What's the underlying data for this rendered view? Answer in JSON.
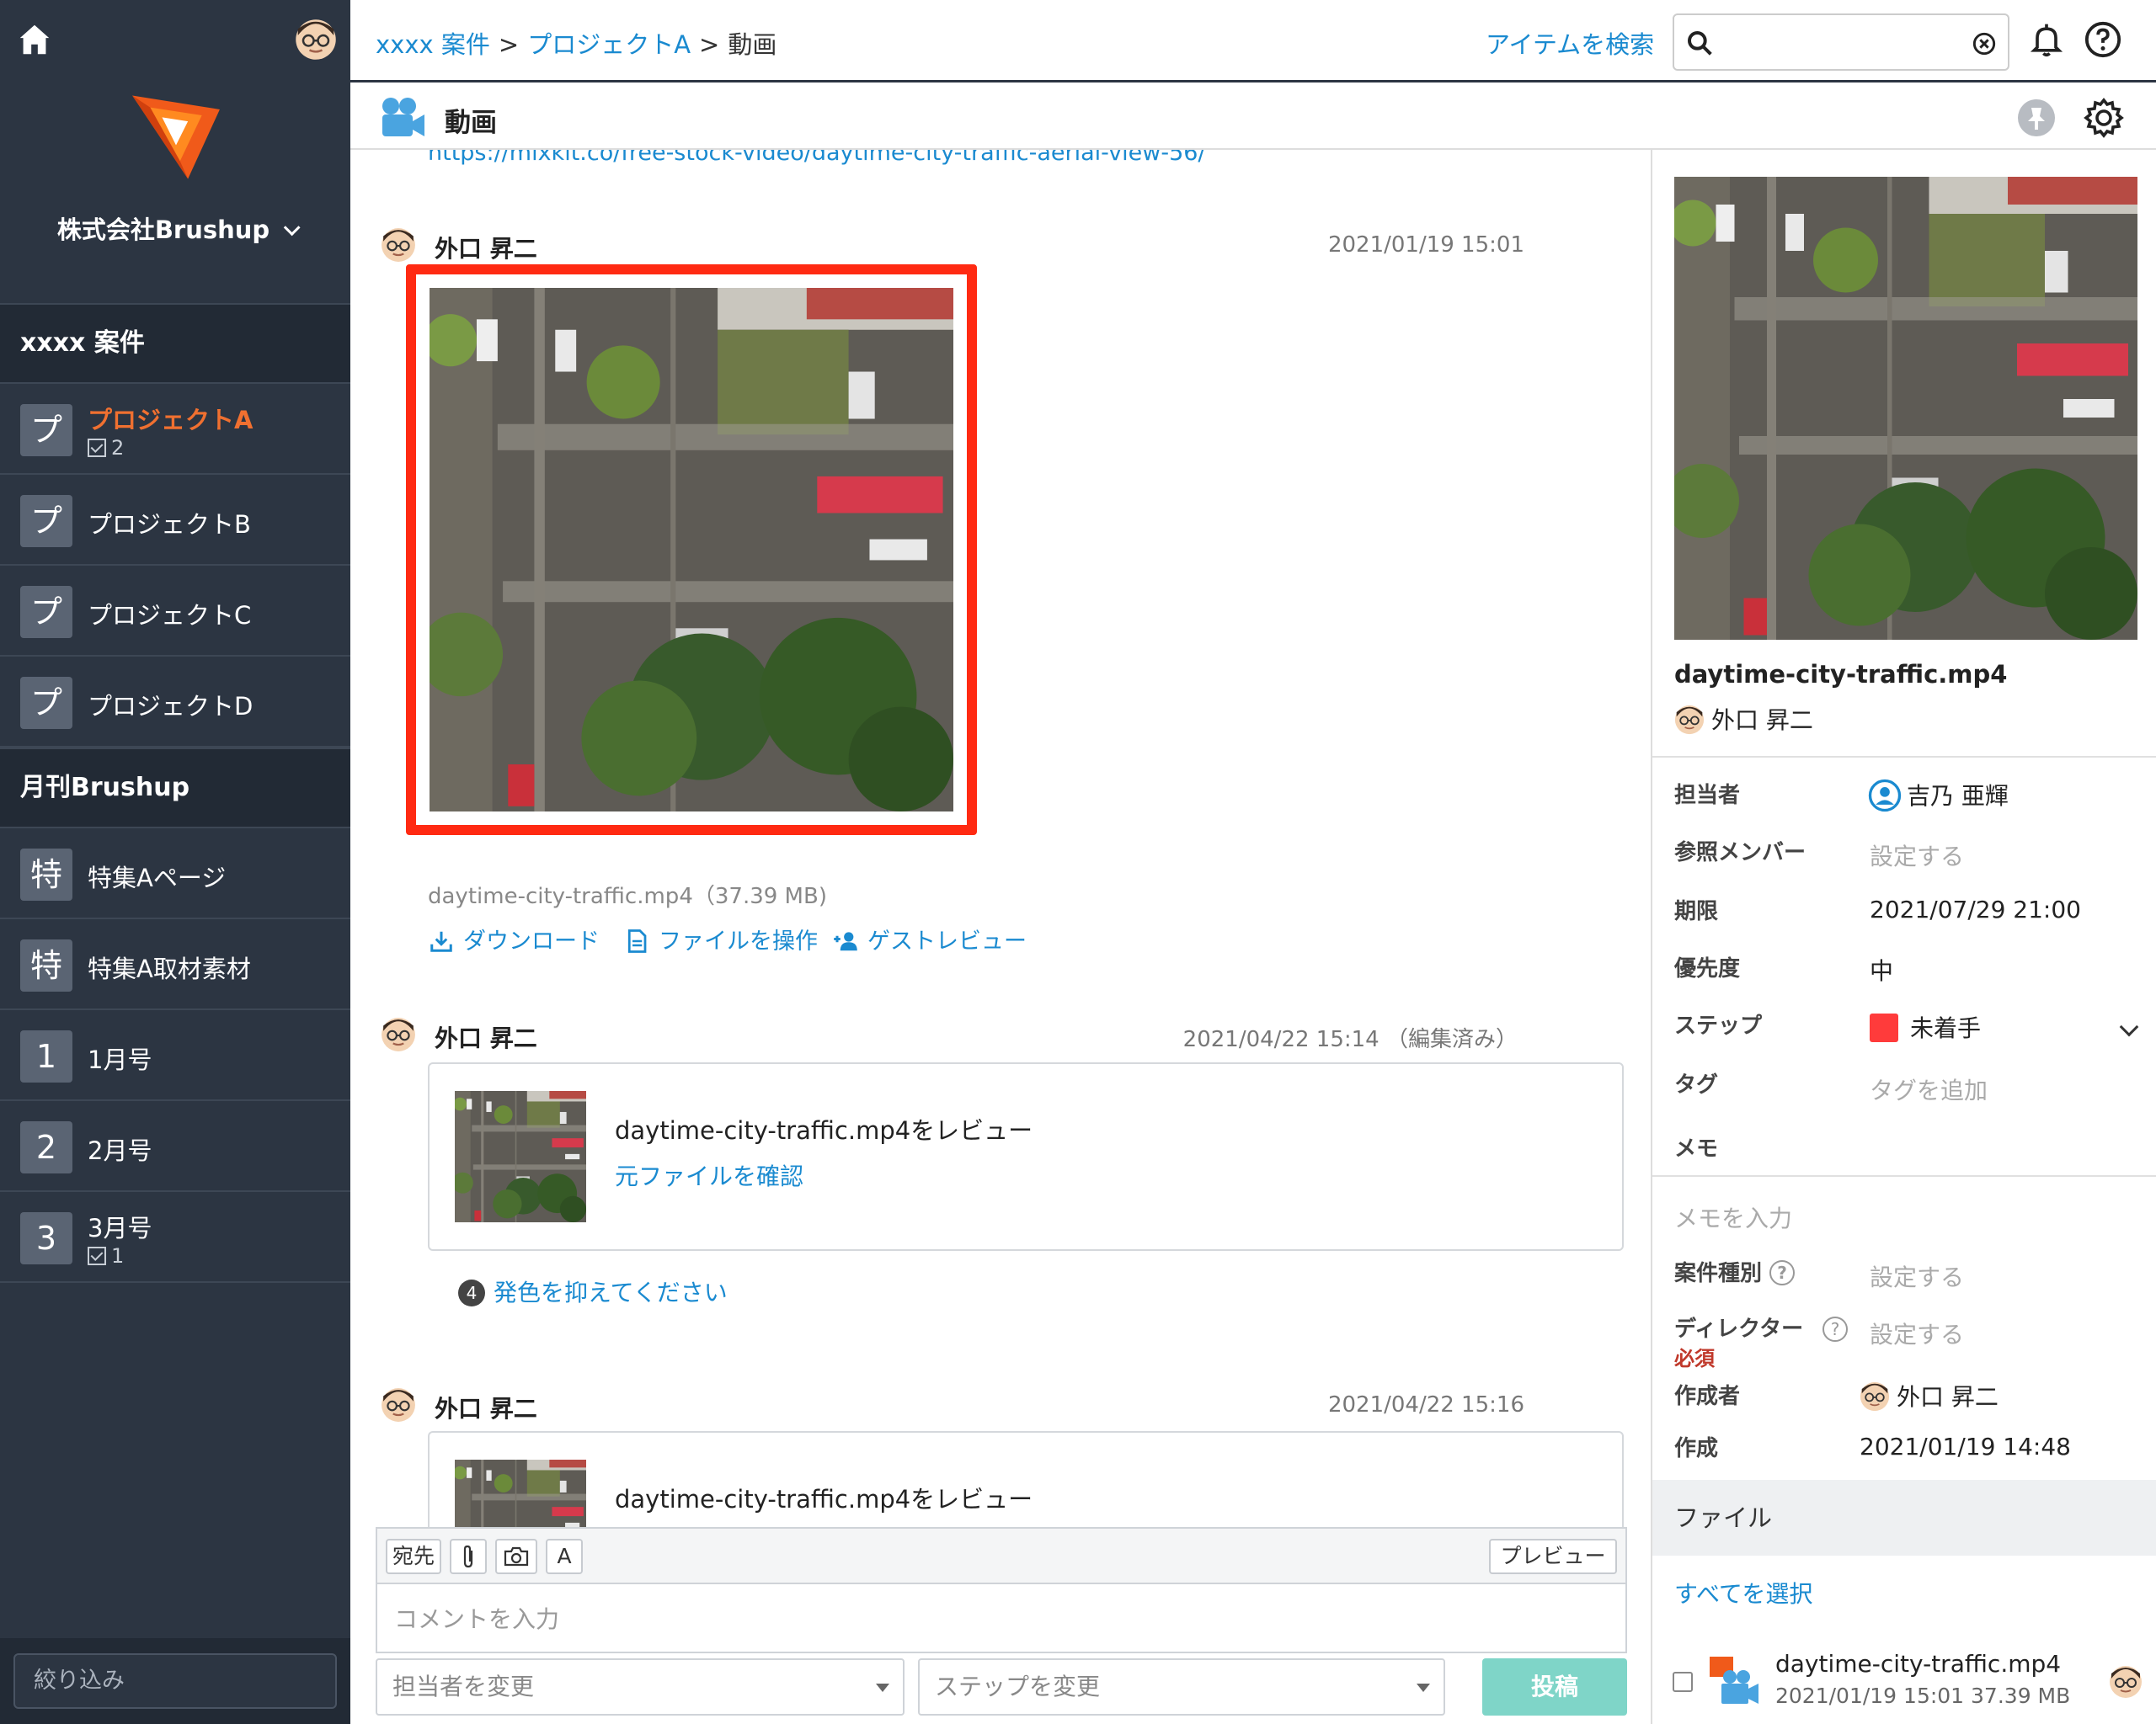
{
  "sidebar": {
    "company": "株式会社Brushup",
    "section1": "xxxx 案件",
    "projects": [
      {
        "tile": "プ",
        "label": "プロジェクトA",
        "count": "2"
      },
      {
        "tile": "プ",
        "label": "プロジェクトB"
      },
      {
        "tile": "プ",
        "label": "プロジェクトC"
      },
      {
        "tile": "プ",
        "label": "プロジェクトD"
      }
    ],
    "section2": "月刊Brushup",
    "items": [
      {
        "tile": "特",
        "label": "特集Aページ"
      },
      {
        "tile": "特",
        "label": "特集A取材素材"
      },
      {
        "tile": "1",
        "label": "1月号"
      },
      {
        "tile": "2",
        "label": "2月号"
      },
      {
        "tile": "3",
        "label": "3月号",
        "count": "1"
      }
    ],
    "filter_placeholder": "絞り込み"
  },
  "topbar": {
    "breadcrumb": [
      "xxxx 案件",
      "プロジェクトA",
      "動画"
    ],
    "separator": ">",
    "search_label": "アイテムを検索",
    "search_value": ""
  },
  "page": {
    "title": "動画"
  },
  "feed": {
    "top_link": "https://mixkit.co/free-stock-video/daytime-city-traffic-aerial-view-56/",
    "posts": [
      {
        "author": "外口 昇二",
        "timestamp": "2021/01/19 15:01",
        "file_caption": "daytime-city-traffic.mp4（37.39 MB)",
        "actions": [
          "ダウンロード",
          "ファイルを操作",
          "ゲストレビュー"
        ]
      },
      {
        "author": "外口 昇二",
        "timestamp": "2021/04/22 15:14 （編集済み）",
        "review_title": "daytime-city-traffic.mp4をレビュー",
        "review_link": "元ファイルを確認",
        "comment_number": "4",
        "comment_text": "発色を抑えてください"
      },
      {
        "author": "外口 昇二",
        "timestamp": "2021/04/22 15:16",
        "review_title": "daytime-city-traffic.mp4をレビュー"
      }
    ]
  },
  "composer": {
    "buttons": [
      "宛先",
      "A"
    ],
    "preview_label": "プレビュー",
    "placeholder": "コメントを入力",
    "assignee_select": "担当者を変更",
    "step_select": "ステップを変更",
    "post_label": "投稿"
  },
  "details": {
    "filename": "daytime-city-traffic.mp4",
    "author": "外口 昇二",
    "props": {
      "assignee_label": "担当者",
      "assignee_value": "吉乃 亜輝",
      "members_label": "参照メンバー",
      "members_value": "設定する",
      "due_label": "期限",
      "due_value": "2021/07/29 21:00",
      "priority_label": "優先度",
      "priority_value": "中",
      "step_label": "ステップ",
      "step_value": "未着手",
      "step_color": "#ff3b3b",
      "tag_label": "タグ",
      "tag_value": "タグを追加",
      "memo_label": "メモ",
      "memo_placeholder": "メモを入力",
      "type_label": "案件種別",
      "type_value": "設定する",
      "director_label": "ディレクター",
      "director_required": "必須",
      "director_value": "設定する",
      "creator_label": "作成者",
      "creator_value": "外口 昇二",
      "created_label": "作成",
      "created_value": "2021/01/19 14:48"
    },
    "files_header": "ファイル",
    "select_all": "すべてを選択",
    "file_row": {
      "name": "daytime-city-traffic.mp4",
      "meta": "2021/01/19 15:01 37.39 MB"
    }
  },
  "colors": {
    "accent": "#1a8ad0",
    "sidebar_bg": "#2c3542",
    "active": "#f07030",
    "highlight": "#ff2a12",
    "post_button": "#7fd5c8"
  }
}
